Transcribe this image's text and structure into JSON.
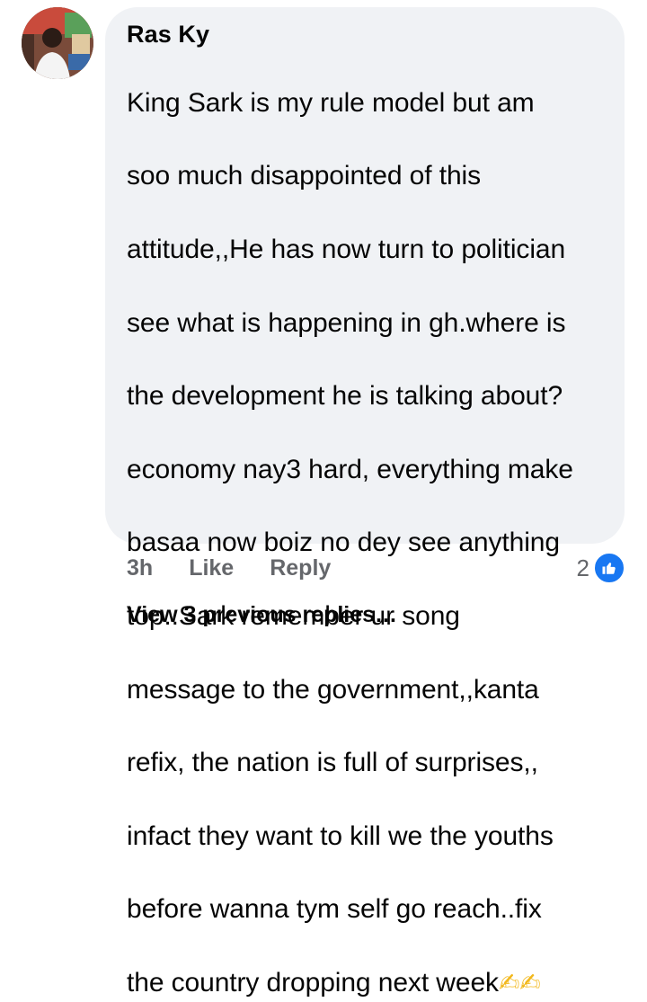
{
  "comment": {
    "author": "Ras Ky",
    "lines": [
      "King Sark is my rule model but am",
      "soo much disappointed of this",
      "attitude,,He has now turn to politician",
      "see what is happening in gh.where is",
      "the development he is talking about?",
      "economy nay3 hard, everything make",
      "basaa now boiz no dey see anything",
      "top..Sark remember ur song",
      "message to the government,,kanta",
      "refix, the nation is full of surprises,,",
      "infact they want to kill we the youths",
      "before wanna tym self go reach..fix",
      "the country dropping next week"
    ],
    "trailing_emoji": "✍✍",
    "time": "3h",
    "like_label": "Like",
    "reply_label": "Reply",
    "reaction_count": "2",
    "reaction_icon": "thumbs-up-icon",
    "view_replies_label": "View 3 previous replies…"
  },
  "colors": {
    "bubble_bg": "#f0f2f5",
    "text": "#050505",
    "meta": "#65676b",
    "like_blue": "#1877f2"
  }
}
